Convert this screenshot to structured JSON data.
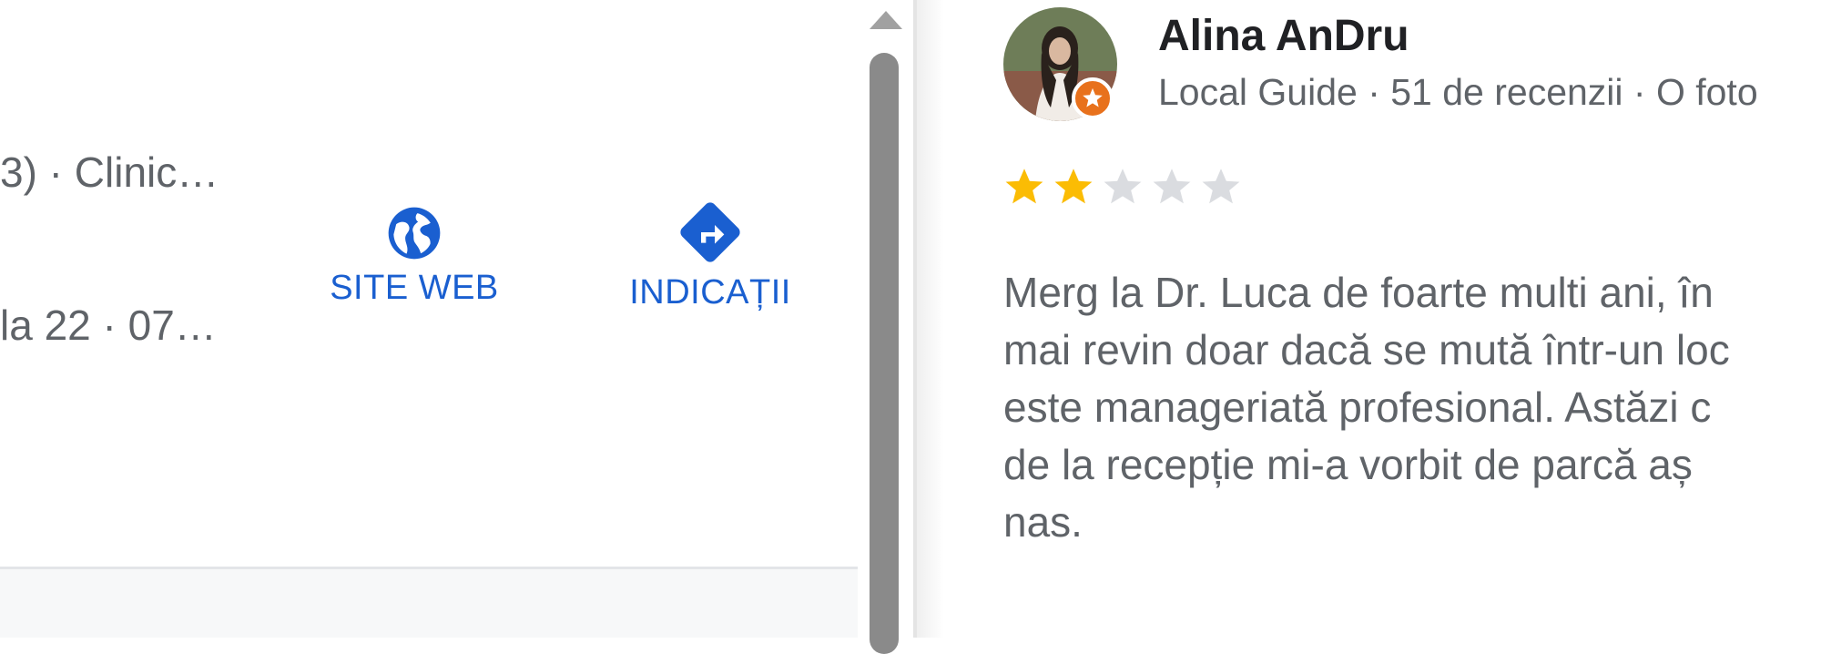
{
  "listing": {
    "rating_snippet": "3) · Clinic…",
    "hours_snippet": "la 22 · 07…",
    "actions": [
      {
        "label": "SITE WEB",
        "icon": "globe-icon"
      },
      {
        "label": "INDICAȚII",
        "icon": "directions-icon"
      }
    ]
  },
  "review": {
    "author": "Alina AnDru",
    "meta": "Local Guide · 51 de recenzii · O foto",
    "rating": 2,
    "rating_max": 5,
    "text_lines": [
      "Merg la Dr. Luca de foarte multi ani, în",
      "mai revin doar dacă se mută într-un loc",
      "este manageriată profesional. Astăzi c",
      "de la recepție mi-a vorbit de parcă aș",
      "nas."
    ]
  },
  "colors": {
    "accent_blue": "#1a5fd0",
    "star_filled": "#fbbc04",
    "star_empty": "#dadce0",
    "local_guide_badge": "#e8711c"
  }
}
